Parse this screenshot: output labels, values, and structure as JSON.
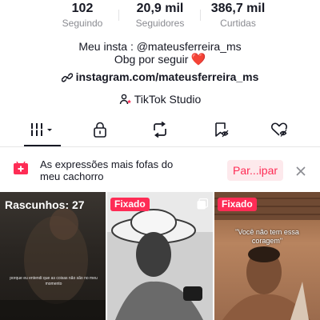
{
  "stats": [
    {
      "value": "102",
      "label": "Seguindo"
    },
    {
      "value": "20,9 mil",
      "label": "Seguidores"
    },
    {
      "value": "386,7 mil",
      "label": "Curtidas"
    }
  ],
  "bio": {
    "line1": "Meu insta : @mateusferreira_ms",
    "line2": "Obg por seguir",
    "heart": "❤️"
  },
  "link": {
    "text": "instagram.com/mateusferreira_ms",
    "icon": "link-icon"
  },
  "studio": {
    "text": "TikTok Studio",
    "icon": "tiktok-studio-icon"
  },
  "tabs": [
    {
      "name": "videos-grid",
      "icon": "grid-bars-icon",
      "active": true
    },
    {
      "name": "private",
      "icon": "lock-icon",
      "active": false
    },
    {
      "name": "reposts",
      "icon": "repost-icon",
      "active": false
    },
    {
      "name": "saved",
      "icon": "bookmark-eye-icon",
      "active": false
    },
    {
      "name": "liked",
      "icon": "heart-eye-icon",
      "active": false
    }
  ],
  "banner": {
    "text": "As expressões mais fofas do meu cachorro",
    "button": "Par...ipar",
    "close": "×"
  },
  "grid": {
    "tile1": {
      "label": "Rascunhos: 27",
      "caption": "porque eu entendi que as coisas não são no meu momento"
    },
    "tile2": {
      "pinned": "Fixado"
    },
    "tile3": {
      "pinned": "Fixado",
      "caption": "\"Você não tem essa coragem\""
    }
  },
  "colors": {
    "accent": "#fe2c55",
    "text": "#161823",
    "muted": "#8a8b91"
  }
}
